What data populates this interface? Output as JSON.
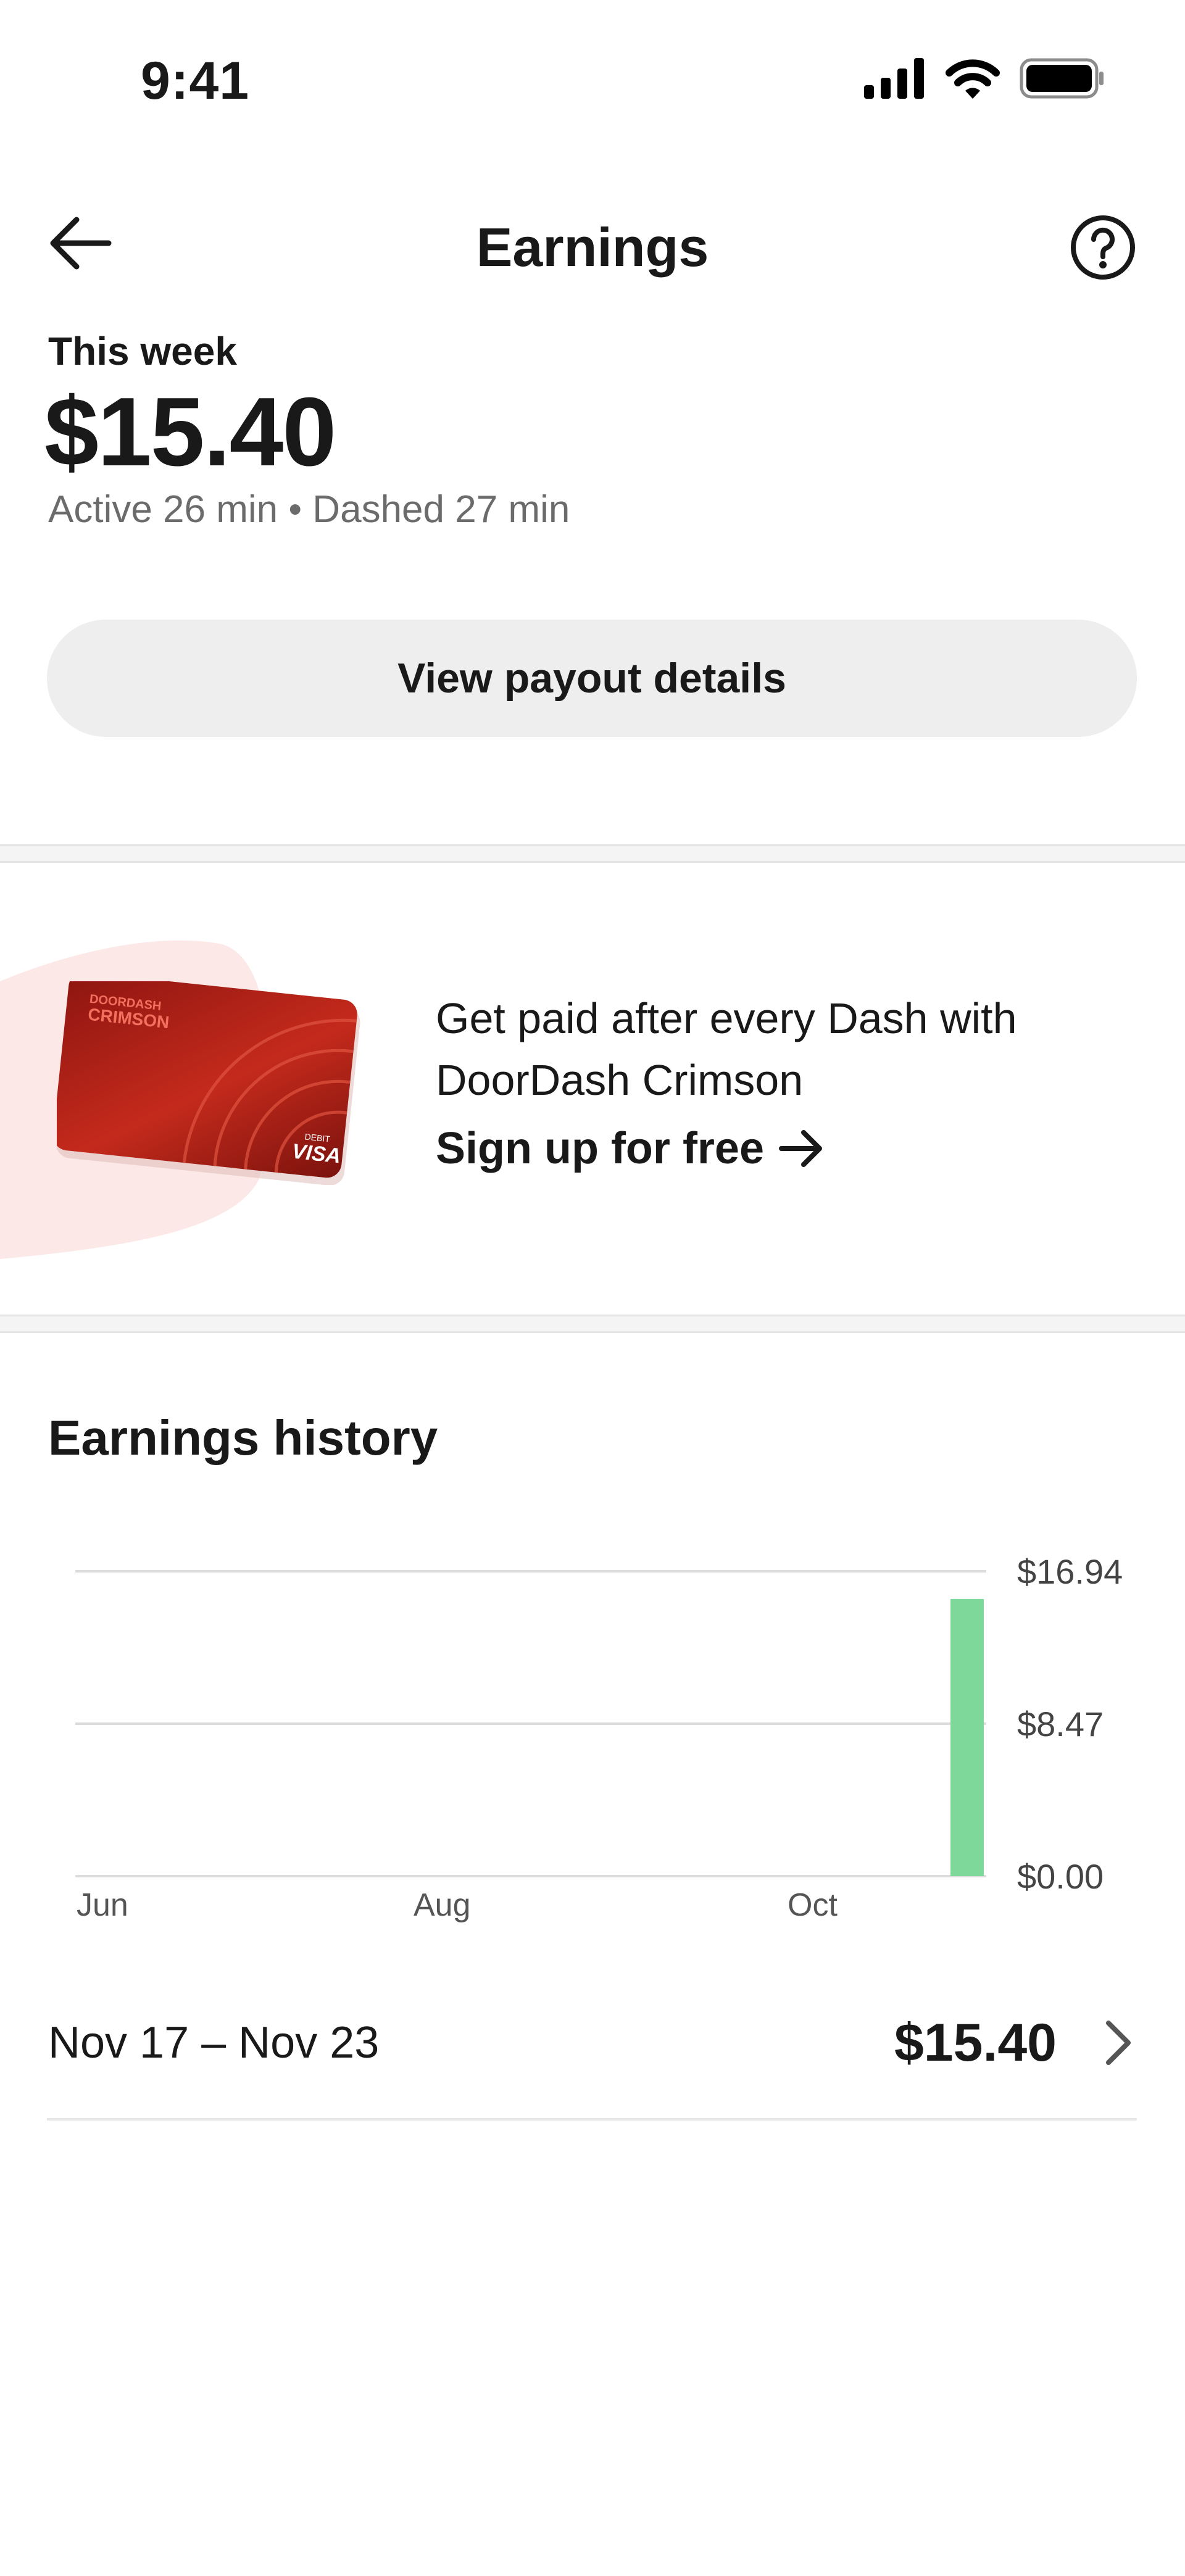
{
  "status_bar": {
    "time": "9:41"
  },
  "header": {
    "title": "Earnings"
  },
  "summary": {
    "period_label": "This week",
    "amount": "$15.40",
    "meta": "Active 26 min • Dashed 27 min"
  },
  "payout_button": {
    "label": "View payout details"
  },
  "promo": {
    "line1": "Get paid after every Dash with",
    "line2": "DoorDash Crimson",
    "link_label": "Sign up for free",
    "card_brand": "DOORDASH",
    "card_name": "CRIMSON",
    "card_type": "DEBIT",
    "card_network": "VISA"
  },
  "history": {
    "title": "Earnings history",
    "rows": [
      {
        "range": "Nov 17 – Nov 23",
        "amount": "$15.40"
      }
    ]
  },
  "chart_data": {
    "type": "bar",
    "x_tick_labels": [
      "Jun",
      "Aug",
      "Oct"
    ],
    "y_tick_labels": [
      "$16.94",
      "$8.47",
      "$0.00"
    ],
    "ylim": [
      0,
      16.94
    ],
    "bars": [
      {
        "week": "Nov 17 – Nov 23",
        "value": 15.4
      }
    ],
    "bar_color": "#7ed89a",
    "grid": true
  },
  "colors": {
    "accent_bar": "#7ed89a",
    "card_red": "#b3201a",
    "muted_text": "#6b6b6b",
    "button_bg": "#eeeeee"
  }
}
